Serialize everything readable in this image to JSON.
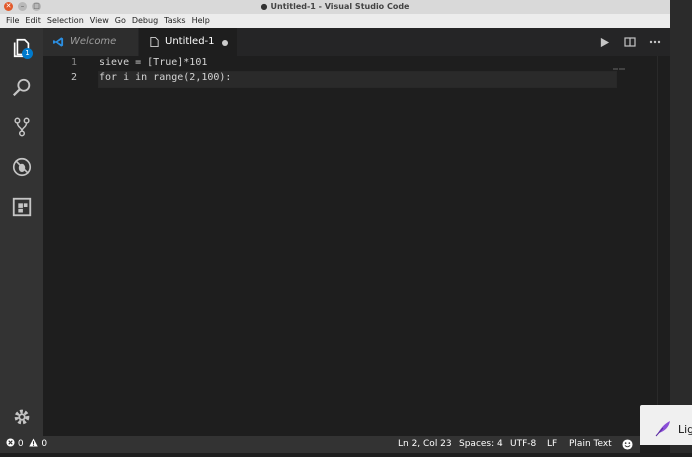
{
  "window": {
    "title": "Untitled-1 - Visual Studio Code"
  },
  "menu": {
    "items": [
      "File",
      "Edit",
      "Selection",
      "View",
      "Go",
      "Debug",
      "Tasks",
      "Help"
    ]
  },
  "activity_bar": {
    "items": [
      "explorer-icon",
      "search-icon",
      "source-control-icon",
      "debug-icon",
      "extensions-icon"
    ],
    "explorer_badge": "1",
    "bottom": "gear-icon"
  },
  "tabs": [
    {
      "label": "Welcome",
      "icon": "vscode-logo-icon",
      "active": false
    },
    {
      "label": "Untitled-1",
      "icon": "file-icon",
      "active": true,
      "dirty": true
    }
  ],
  "editor": {
    "lines": [
      {
        "number": "1",
        "text": "sieve = [True]*101"
      },
      {
        "number": "2",
        "text": "for i in range(2,100):"
      }
    ],
    "current_line": 2
  },
  "statusbar": {
    "errors": "0",
    "warnings": "0",
    "position": "Ln 2, Col 23",
    "spaces": "Spaces: 4",
    "encoding": "UTF-8",
    "eol": "LF",
    "language": "Plain Text"
  },
  "notification": {
    "label": "Lig"
  },
  "colors": {
    "accent": "#007acc",
    "editor_bg": "#1e1e1e",
    "activity_bg": "#333333",
    "close_button": "#e25a2b"
  }
}
